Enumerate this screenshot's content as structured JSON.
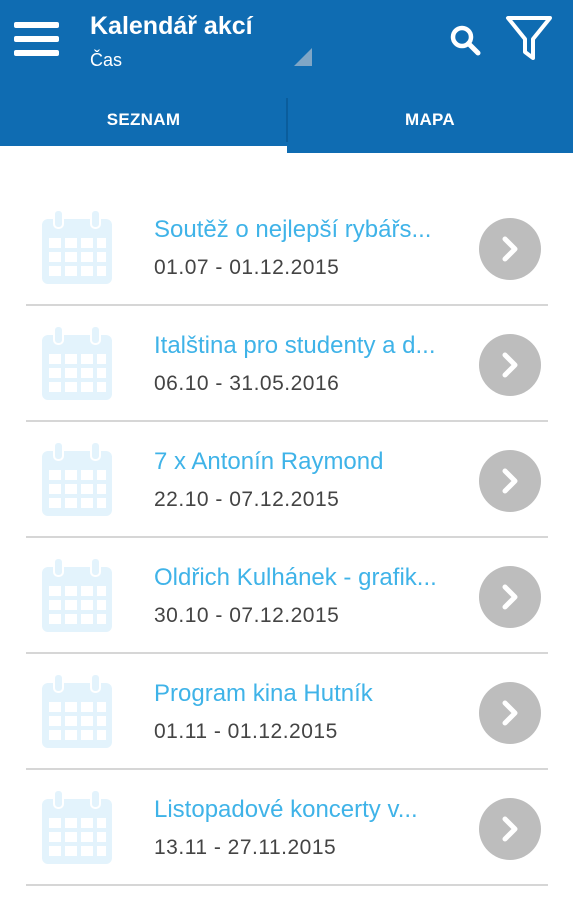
{
  "header": {
    "title": "Kalendář akcí",
    "subtitle": "Čas",
    "background_color": "#0f6cb2",
    "menu_icon": "hamburger-menu-icon",
    "search_icon": "search-icon",
    "filter_icon": "filter-funnel-icon"
  },
  "tabs": [
    {
      "label": "SEZNAM",
      "selected": true
    },
    {
      "label": "MAPA",
      "selected": false
    }
  ],
  "events": [
    {
      "title": "Soutěž o nejlepší rybářs...",
      "dates": "01.07 - 01.12.2015"
    },
    {
      "title": "Italština pro studenty a d...",
      "dates": "06.10 - 31.05.2016"
    },
    {
      "title": "7 x Antonín Raymond",
      "dates": "22.10 - 07.12.2015"
    },
    {
      "title": "Oldřich Kulhánek - grafik...",
      "dates": "30.10 - 07.12.2015"
    },
    {
      "title": "Program kina Hutník",
      "dates": "01.11 - 01.12.2015"
    },
    {
      "title": "Listopadové koncerty v...",
      "dates": "13.11 - 27.11.2015"
    }
  ],
  "colors": {
    "accent": "#0f6cb2",
    "event_title": "#3fb3e8",
    "calendar_icon": "#e3f3fc",
    "chevron_circle": "#bdbdbd"
  },
  "row_icons": {
    "calendar": "calendar-icon",
    "chevron": "chevron-right-icon"
  }
}
